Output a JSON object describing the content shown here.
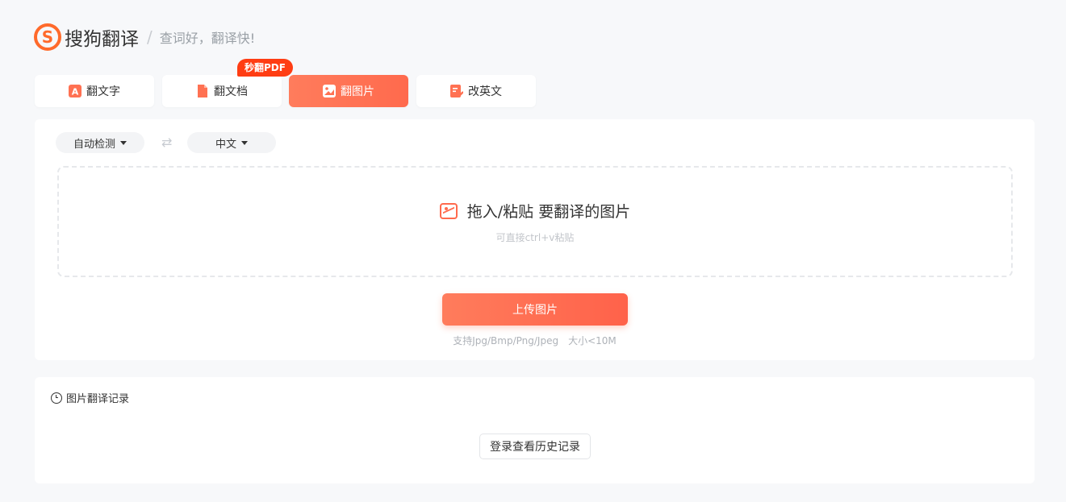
{
  "header": {
    "logo_letter": "S",
    "app_name": "搜狗翻译",
    "separator": "/",
    "slogan": "查词好，翻译快!"
  },
  "tabs": [
    {
      "label": "翻文字",
      "icon": "text-a-icon",
      "active": false
    },
    {
      "label": "翻文档",
      "icon": "document-icon",
      "active": false
    },
    {
      "label": "翻图片",
      "icon": "image-icon",
      "active": true
    },
    {
      "label": "改英文",
      "icon": "edit-check-icon",
      "active": false
    }
  ],
  "pdf_badge": "秒翻PDF",
  "translator": {
    "source_lang": "自动检测",
    "target_lang": "中文",
    "swap_symbol": "⇄",
    "drop_title": "拖入/粘贴 要翻译的图片",
    "drop_hint": "可直接ctrl+v粘贴",
    "upload_label": "上传图片",
    "formats": "支持Jpg/Bmp/Png/Jpeg",
    "size_limit": "大小<10M"
  },
  "history": {
    "title": "图片翻译记录",
    "login_label": "登录查看历史记录"
  },
  "colors": {
    "accent": "#ff6a4d",
    "badge": "#ff3d13",
    "logo": "#ff6a2b"
  }
}
